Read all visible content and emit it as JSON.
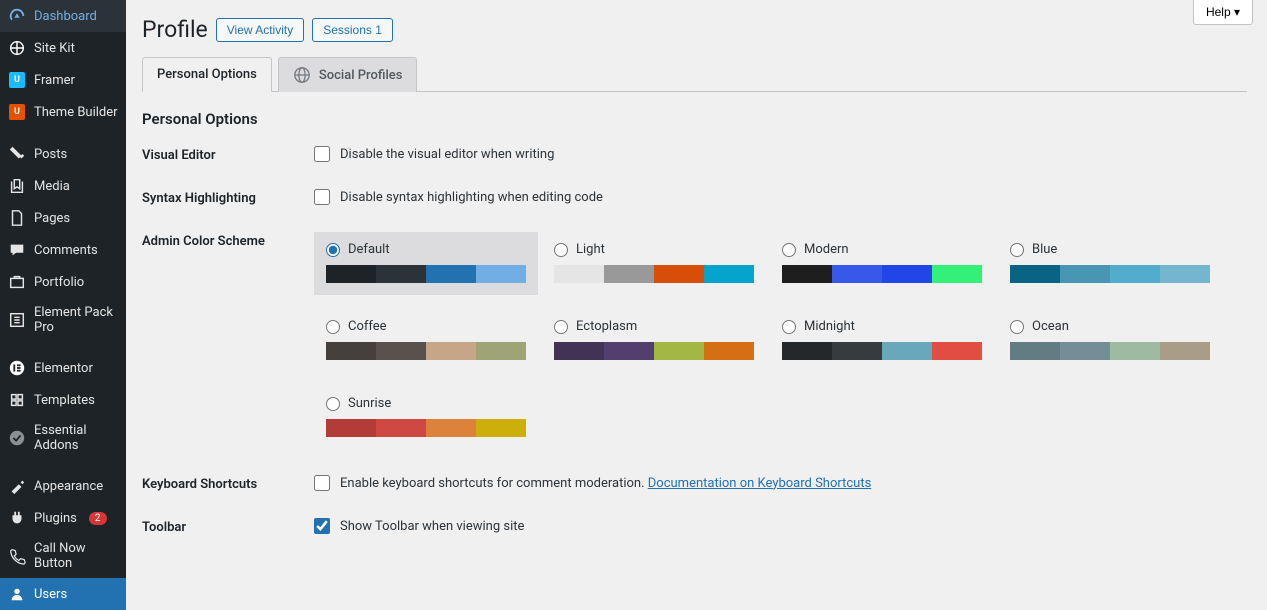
{
  "help_label": "Help ▾",
  "page_title": "Profile",
  "view_activity_label": "View Activity",
  "sessions_label": "Sessions 1",
  "tabs": {
    "personal": "Personal Options",
    "social": "Social Profiles"
  },
  "section_title": "Personal Options",
  "sidebar": [
    {
      "label": "Dashboard",
      "icon": "dashboard"
    },
    {
      "label": "Site Kit",
      "icon": "sitekit"
    },
    {
      "label": "Framer",
      "icon": "framer"
    },
    {
      "label": "Theme Builder",
      "icon": "themebuilder"
    },
    {
      "sep": true
    },
    {
      "label": "Posts",
      "icon": "posts"
    },
    {
      "label": "Media",
      "icon": "media"
    },
    {
      "label": "Pages",
      "icon": "pages"
    },
    {
      "label": "Comments",
      "icon": "comments"
    },
    {
      "label": "Portfolio",
      "icon": "portfolio"
    },
    {
      "label": "Element Pack Pro",
      "icon": "elementpack"
    },
    {
      "sep": true
    },
    {
      "label": "Elementor",
      "icon": "elementor"
    },
    {
      "label": "Templates",
      "icon": "templates"
    },
    {
      "label": "Essential Addons",
      "icon": "ea"
    },
    {
      "sep": true
    },
    {
      "label": "Appearance",
      "icon": "appearance"
    },
    {
      "label": "Plugins",
      "icon": "plugins",
      "badge": "2"
    },
    {
      "label": "Call Now Button",
      "icon": "callnow"
    },
    {
      "label": "Users",
      "icon": "users",
      "active": true
    }
  ],
  "fields": {
    "visual_editor": {
      "label": "Visual Editor",
      "text": "Disable the visual editor when writing",
      "checked": false
    },
    "syntax": {
      "label": "Syntax Highlighting",
      "text": "Disable syntax highlighting when editing code",
      "checked": false
    },
    "color_scheme": {
      "label": "Admin Color Scheme"
    },
    "keyboard": {
      "label": "Keyboard Shortcuts",
      "text": "Enable keyboard shortcuts for comment moderation. ",
      "link": "Documentation on Keyboard Shortcuts",
      "checked": false
    },
    "toolbar": {
      "label": "Toolbar",
      "text": "Show Toolbar when viewing site",
      "checked": true
    }
  },
  "schemes": [
    {
      "name": "Default",
      "selected": true,
      "colors": [
        "#1d2327",
        "#2c3338",
        "#2271b1",
        "#72aee6"
      ]
    },
    {
      "name": "Light",
      "colors": [
        "#e5e5e5",
        "#999999",
        "#d64e07",
        "#04a4cc"
      ]
    },
    {
      "name": "Modern",
      "colors": [
        "#1e1e1e",
        "#3858e9",
        "#2145e6",
        "#33f078"
      ]
    },
    {
      "name": "Blue",
      "colors": [
        "#096484",
        "#4796b3",
        "#52accc",
        "#74B6CE"
      ]
    },
    {
      "name": "Coffee",
      "colors": [
        "#46403c",
        "#59524c",
        "#c7a589",
        "#9ea476"
      ]
    },
    {
      "name": "Ectoplasm",
      "colors": [
        "#413256",
        "#523f6d",
        "#a3b745",
        "#d46f15"
      ]
    },
    {
      "name": "Midnight",
      "colors": [
        "#25282b",
        "#363b3f",
        "#69a8bb",
        "#e14d43"
      ]
    },
    {
      "name": "Ocean",
      "colors": [
        "#627c83",
        "#738e96",
        "#9ebaa0",
        "#aa9d88"
      ]
    },
    {
      "name": "Sunrise",
      "colors": [
        "#b43c38",
        "#cf4944",
        "#dd823b",
        "#ccaf0b"
      ]
    }
  ]
}
